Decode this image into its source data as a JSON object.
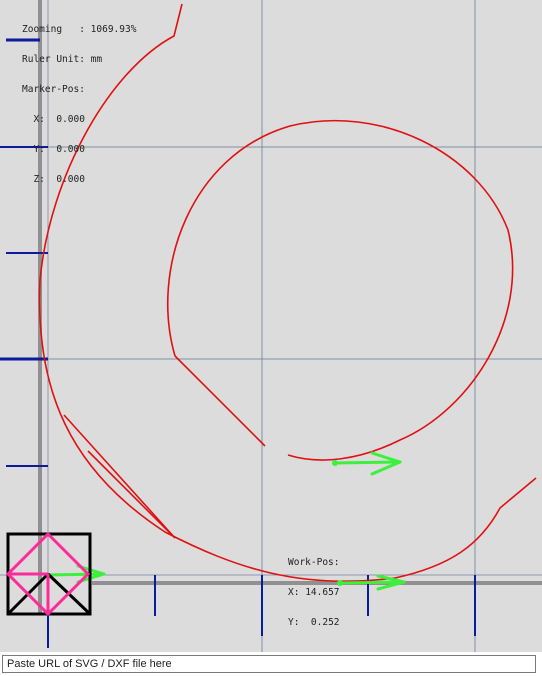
{
  "info": {
    "zoom_label": "Zooming   :",
    "zoom_value": "1069.93%",
    "ruler_unit_label": "Ruler Unit:",
    "ruler_unit_value": "mm",
    "marker_pos_label": "Marker-Pos:",
    "marker_x_label": "X:",
    "marker_x_value": "0.000",
    "marker_y_label": "Y:",
    "marker_y_value": "0.000",
    "marker_z_label": "Z:",
    "marker_z_value": "0.000"
  },
  "work_pos": {
    "label": "Work-Pos:",
    "x_label": "X:",
    "x_value": "14.657",
    "y_label": "Y:",
    "y_value": "0.252"
  },
  "url_input": {
    "placeholder": "Paste URL of SVG / DXF file here",
    "value": ""
  },
  "colors": {
    "canvas_bg": "#dcdcdc",
    "grid": "#7f8fa3",
    "axis": "#909090",
    "ruler_tick": "#0c1a9c",
    "toolpath": "#e01010",
    "direction_arrow": "#3cf03c",
    "tool_square": "#000000",
    "tool_diamond": "#ff2a9a"
  },
  "icons": {
    "origin_marker": "square-with-diamond-icon",
    "direction_marker": "green-arrow-icon"
  }
}
